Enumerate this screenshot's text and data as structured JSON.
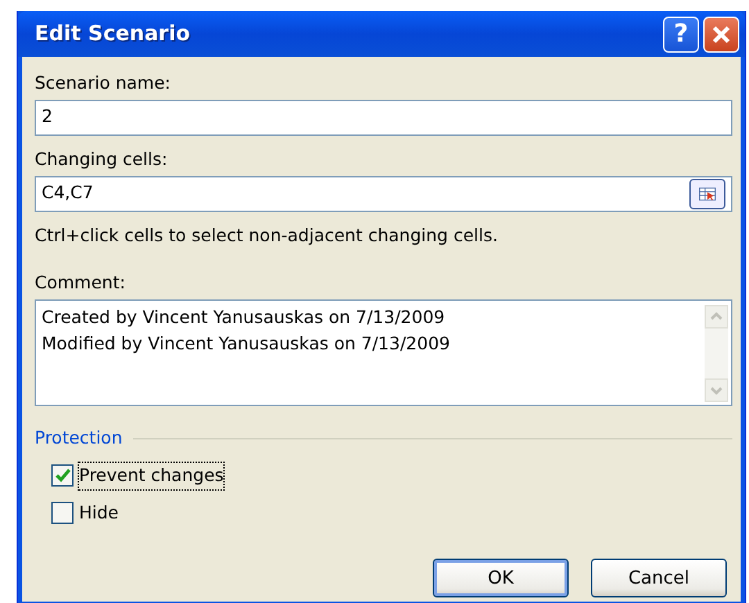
{
  "window": {
    "title": "Edit Scenario",
    "buttons": [
      {
        "kind": "help",
        "label": "?"
      },
      {
        "kind": "close"
      }
    ]
  },
  "scenario_name": {
    "label": "Scenario name:",
    "value": "2"
  },
  "changing_cells": {
    "label": "Changing cells:",
    "value": "C4,C7",
    "hint": "Ctrl+click cells to select non-adjacent changing cells."
  },
  "comment": {
    "label": "Comment:",
    "lines": [
      "Created by Vincent Yanusauskas on 7/13/2009",
      "Modified by Vincent Yanusauskas on 7/13/2009"
    ]
  },
  "protection": {
    "title": "Protection",
    "options": [
      {
        "label": "Prevent changes",
        "checked": true,
        "focused": true
      },
      {
        "label": "Hide",
        "checked": false,
        "focused": false
      }
    ]
  },
  "buttons": [
    {
      "label": "OK",
      "default": true
    },
    {
      "label": "Cancel",
      "default": false
    }
  ]
}
